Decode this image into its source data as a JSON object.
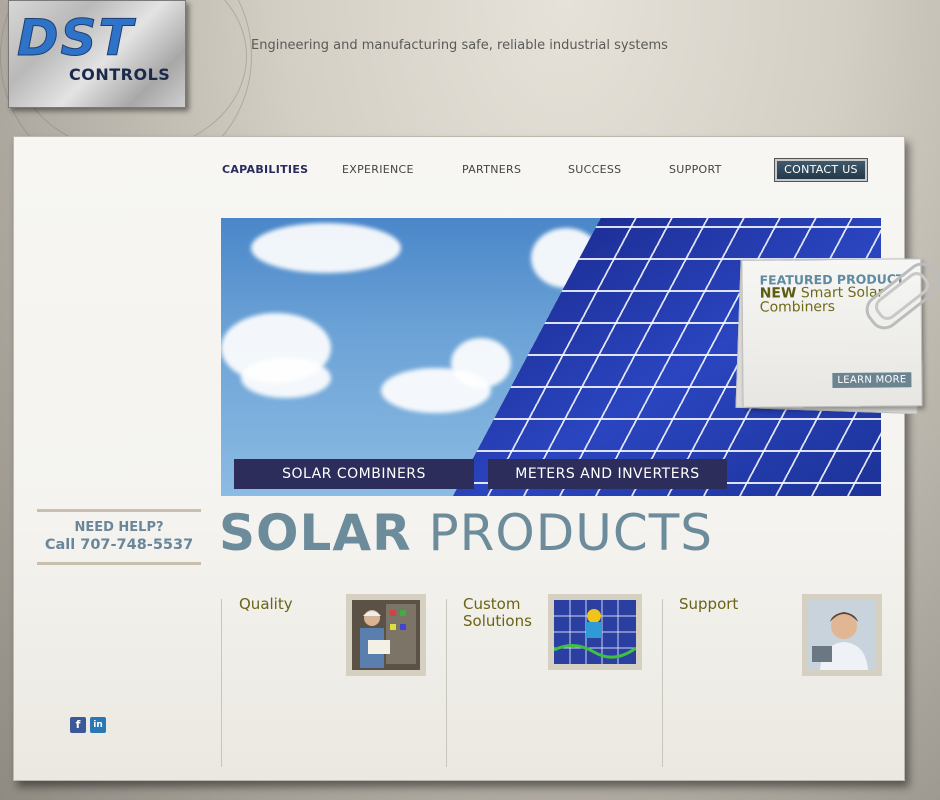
{
  "header": {
    "logo_main": "DST",
    "logo_sub": "CONTROLS",
    "tagline": "Engineering and manufacturing safe, reliable industrial systems"
  },
  "nav": {
    "items": [
      "CAPABILITIES",
      "EXPERIENCE",
      "PARTNERS",
      "SUCCESS",
      "SUPPORT"
    ],
    "active": "CAPABILITIES",
    "contact_label": "CONTACT US"
  },
  "hero": {
    "buttons": [
      "SOLAR COMBINERS",
      "METERS AND INVERTERS"
    ]
  },
  "featured": {
    "title": "FEATURED PRODUCT",
    "new_word": "NEW",
    "line1_rest": " Smart Solar",
    "line2": "Combiners",
    "button": "LEARN MORE"
  },
  "help": {
    "title": "NEED HELP?",
    "phone": "Call 707-748-5537"
  },
  "page": {
    "heading_bold": "SOLAR",
    "heading_light": "PRODUCTS"
  },
  "features": [
    {
      "label": "Quality",
      "icon": "worker-photo"
    },
    {
      "label": "Custom\nSolutions",
      "icon": "solar-installer-photo"
    },
    {
      "label": "Support",
      "icon": "support-agent-photo"
    }
  ],
  "social": {
    "facebook": "f",
    "linkedin": "in"
  },
  "colors": {
    "accent_navy": "#2c2d5b",
    "heading_blue": "#6d8c9b",
    "olive_text": "#6b6316"
  }
}
